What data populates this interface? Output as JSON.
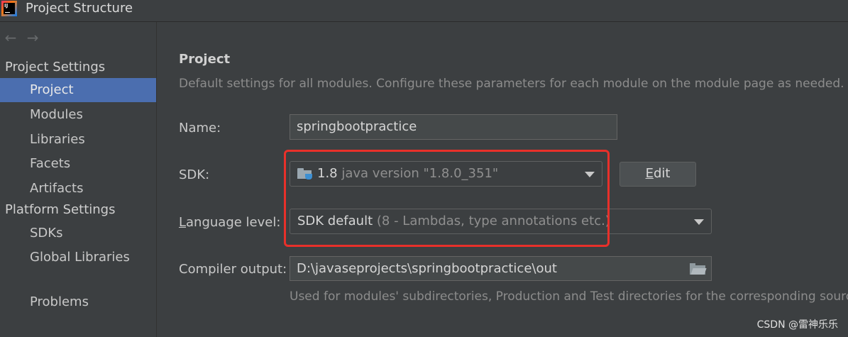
{
  "window": {
    "title": "Project Structure",
    "app_icon_text": "IJ"
  },
  "nav": {
    "back_arrow": "←",
    "forward_arrow": "→"
  },
  "sidebar": {
    "project_settings_header": "Project Settings",
    "platform_settings_header": "Platform Settings",
    "items": [
      {
        "label": "Project",
        "selected": true
      },
      {
        "label": "Modules"
      },
      {
        "label": "Libraries"
      },
      {
        "label": "Facets"
      },
      {
        "label": "Artifacts"
      },
      {
        "label": "SDKs"
      },
      {
        "label": "Global Libraries"
      },
      {
        "label": "Problems"
      }
    ]
  },
  "main": {
    "title": "Project",
    "description": "Default settings for all modules. Configure these parameters for each module on the module page as needed.",
    "name_label": "Name:",
    "name_value": "springbootpractice",
    "sdk_label": "SDK:",
    "sdk_version": "1.8",
    "sdk_detail": "java version \"1.8.0_351\"",
    "sdk_icon": "folder-java-icon",
    "edit_mnemonic": "E",
    "edit_rest": "dit",
    "language_level_mnemonic": "L",
    "language_level_rest": "anguage level:",
    "language_level_value": "SDK default",
    "language_level_detail": "(8 - Lambdas, type annotations etc.)",
    "compiler_output_label": "Compiler output:",
    "compiler_output_value": "D:\\javaseprojects\\springbootpractice\\out",
    "compiler_output_hint": "Used for modules' subdirectories, Production and Test directories for the corresponding sources."
  },
  "annotation": {
    "highlight_color": "#e8302a"
  },
  "watermark": "CSDN @雷神乐乐",
  "colors": {
    "selection": "#4b6eaf",
    "background": "#3c3f41"
  }
}
